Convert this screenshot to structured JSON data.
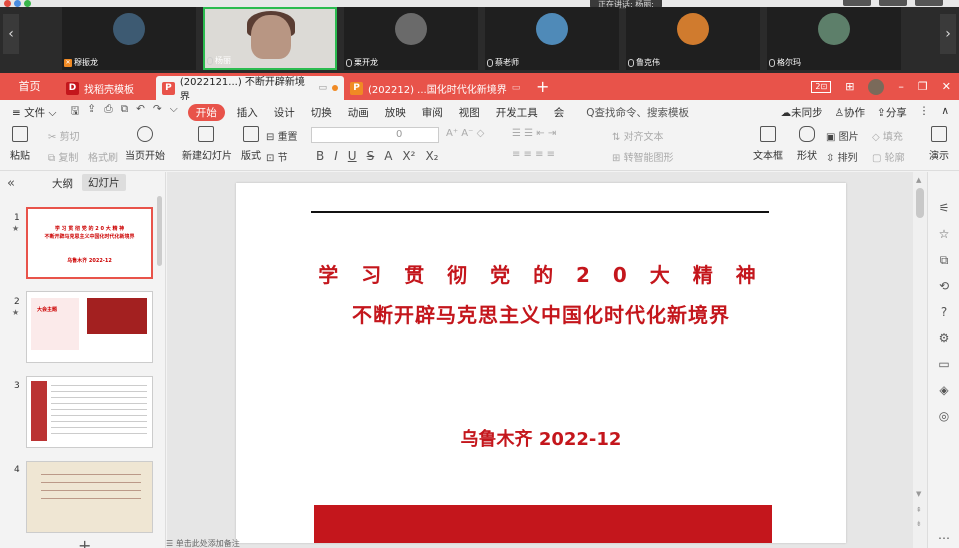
{
  "conference": {
    "speaking_label": "正在讲话: 杨丽;",
    "tiles": [
      {
        "name": "穆振龙",
        "muted": true
      },
      {
        "name": "杨丽",
        "muted": false,
        "active": true
      },
      {
        "name": "栗开龙",
        "muted": false
      },
      {
        "name": "蔡老师",
        "muted": false
      },
      {
        "name": "鲁克伟",
        "muted": false
      },
      {
        "name": "格尔玛",
        "muted": false
      }
    ],
    "prev_arrow": "‹",
    "next_arrow": "›"
  },
  "tabs": {
    "home": "首页",
    "template_tab": "找稻壳模板",
    "doc1": "(2022121...) 不断开辟新境界",
    "doc2": "(202212) ...国化时代化新境界",
    "add": "+",
    "window_box": "2⊡"
  },
  "menu": {
    "file": "≡ 文件 ⌵",
    "items": [
      "开始",
      "插入",
      "设计",
      "切换",
      "动画",
      "放映",
      "审阅",
      "视图",
      "开发工具",
      "会"
    ],
    "search": "Q查找命令、搜索模板",
    "sync": "未同步",
    "collab": "协作",
    "share": "分享"
  },
  "ribbon": {
    "paste": "粘贴",
    "cut": "剪切",
    "copy": "复制",
    "format_painter": "格式刷",
    "play_from_current": "当页开始",
    "new_slide": "新建幻灯片",
    "layout": "版式",
    "section": "节",
    "reset": "重置",
    "font_size": "0",
    "para_text_dir": "对齐文本",
    "smart_shape": "转智能图形",
    "textbox": "文本框",
    "shape": "形状",
    "picture": "图片",
    "fill": "填充",
    "arrange": "排列",
    "outline": "轮廓",
    "presenter": "演示"
  },
  "left_panel": {
    "tab_outline": "大纲",
    "tab_slides": "幻灯片",
    "thumbnails": [
      {
        "num": "1",
        "line1": "学 习 贯 彻 党 的 2 0 大 精 神",
        "line2": "不断开辟马克思主义中国化时代化新境界",
        "date": "乌鲁木齐 2022-12"
      },
      {
        "num": "2",
        "title": "大会主题"
      },
      {
        "num": "3"
      },
      {
        "num": "4"
      }
    ]
  },
  "slide": {
    "title_line1": "学 习 贯 彻 党 的 2 0 大 精 神",
    "title_line2": "不断开辟马克思主义中国化时代化新境界",
    "date_line": "乌鲁木齐 2022-12"
  },
  "status": {
    "notes_hint": "单击此处添加备注"
  },
  "colors": {
    "wps_red": "#e8534a",
    "slide_red": "#c4161c",
    "active_speaker": "#2bbb4f"
  }
}
